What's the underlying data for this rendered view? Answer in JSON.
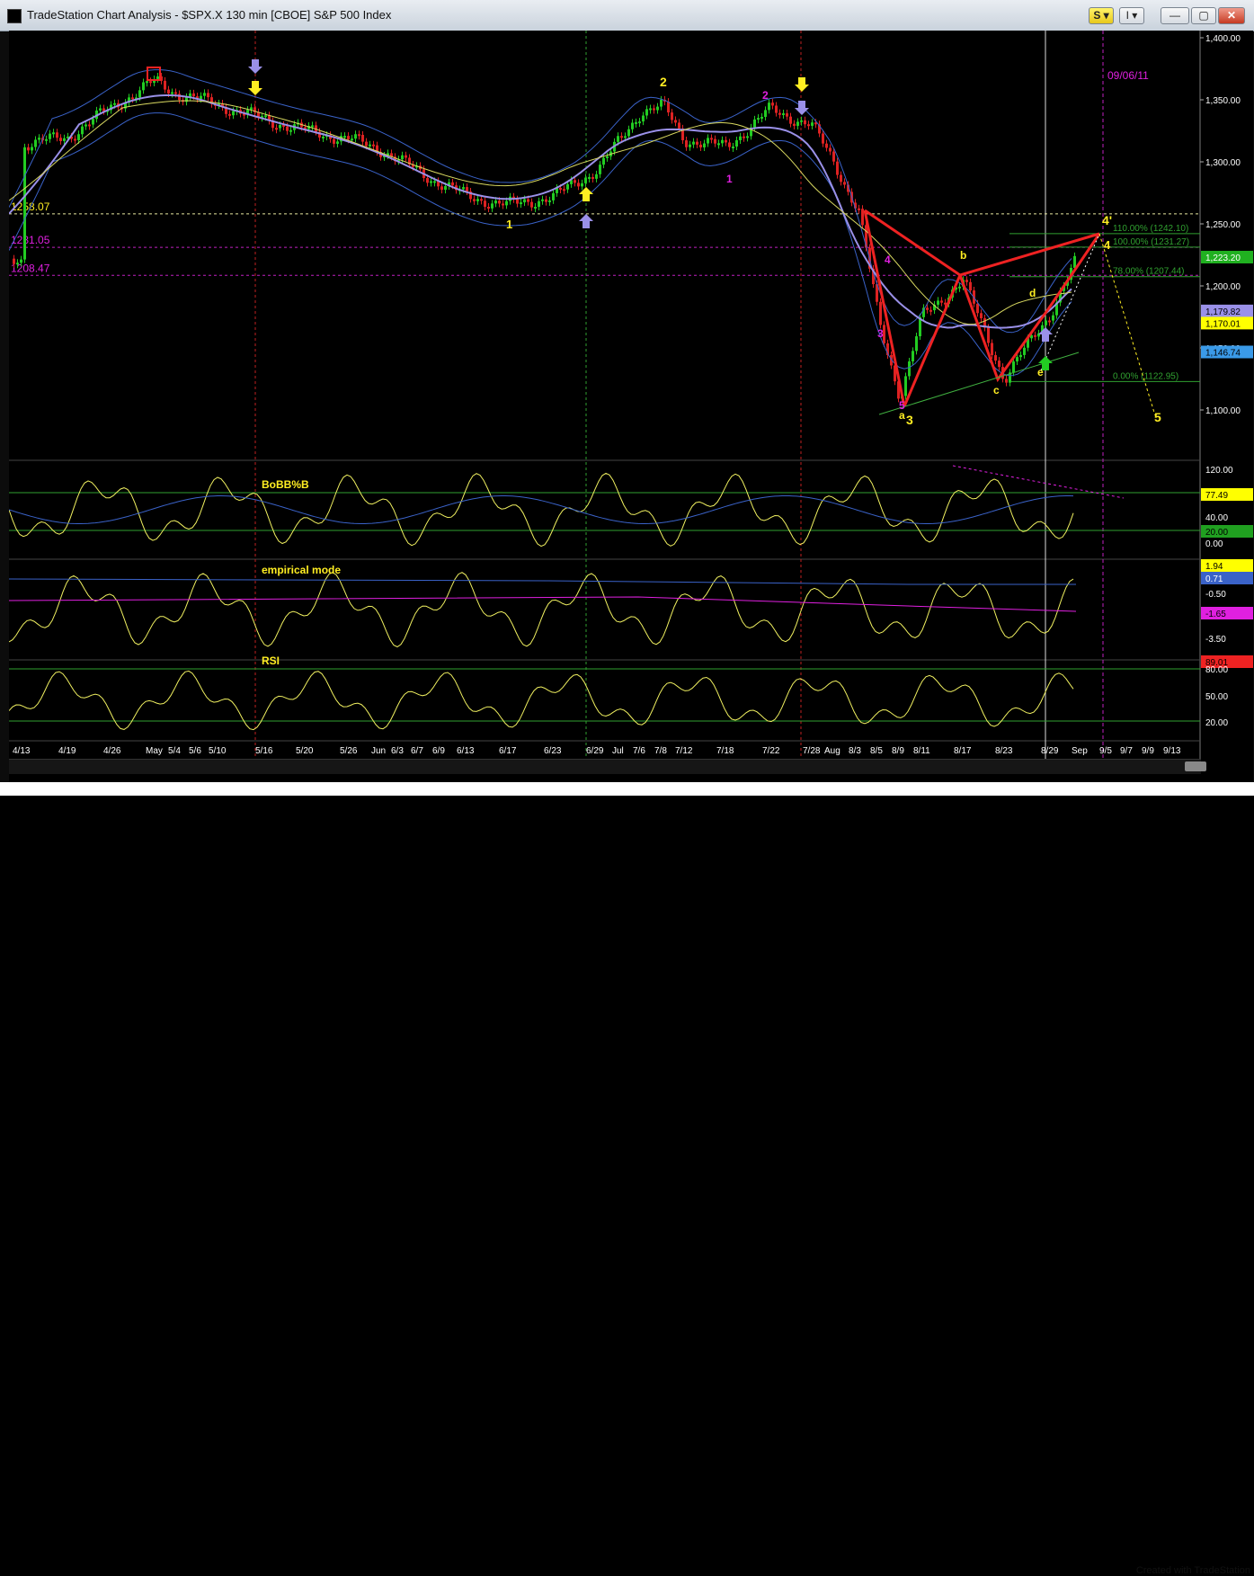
{
  "window": {
    "title": "TradeStation Chart Analysis - $SPX.X 130 min [CBOE] S&P 500 Index",
    "buttons": {
      "s": "S ▾",
      "indicator": "I ▾",
      "minimize": "—",
      "maximize": "▢",
      "close": "✕"
    },
    "credit": "Created with TradeStation"
  },
  "colors": {
    "background": "#000000",
    "price_bar": "#22cc22",
    "price_bar_down": "#dd2222",
    "bollinger": "#3a62c8",
    "ma_purple": "#9a90e8",
    "ma_yellow": "#d8d860",
    "wave_label": "#ffee22",
    "wave_label_magenta": "#e020e0",
    "pattern_red": "#ee2222",
    "hline_magenta": "#c020c0",
    "hline_yellow": "#e8e8a0",
    "fib_green": "#30a030",
    "indicator_line": "#f0f060",
    "axis_text": "#ffffff"
  },
  "price_axis": {
    "ticks": [
      "1,400.00",
      "1,350.00",
      "1,300.00",
      "1,250.00",
      "1,200.00",
      "1,150.00",
      "1,100.00"
    ],
    "badges": [
      {
        "value": 1223.2,
        "label": "1,223.20",
        "bg": "#20b020",
        "fg": "#ffffff"
      },
      {
        "value": 1179.82,
        "label": "1,179.82",
        "bg": "#9a90e8",
        "fg": "#000000"
      },
      {
        "value": 1170.01,
        "label": "1,170.01",
        "bg": "#ffff00",
        "fg": "#000000"
      },
      {
        "value": 1146.74,
        "label": "1,146.74",
        "bg": "#3a9ae8",
        "fg": "#000000"
      }
    ]
  },
  "horizontal_levels": [
    {
      "value": 1258.07,
      "label": "1258.07",
      "color": "#e8e8a0",
      "label_color": "#ffee22"
    },
    {
      "value": 1231.05,
      "label": "1231.05",
      "color": "#c020c0",
      "label_color": "#e020e0"
    },
    {
      "value": 1208.47,
      "label": "1208.47",
      "color": "#c020c0",
      "label_color": "#e020e0"
    }
  ],
  "fib_labels": [
    {
      "value": 1242.1,
      "label": "110.00% (1242.10)"
    },
    {
      "value": 1231.27,
      "label": "100.00% (1231.27)"
    },
    {
      "value": 1207.44,
      "label": "78.00% (1207.44)"
    },
    {
      "value": 1122.95,
      "label": "0.00% (1122.95)"
    }
  ],
  "date_marker": "09/06/11",
  "x_axis_labels": [
    "4/13",
    "4/19",
    "4/26",
    "May",
    "5/4",
    "5/6",
    "5/10",
    "5/16",
    "5/20",
    "5/26",
    "Jun",
    "6/3",
    "6/7",
    "6/9",
    "6/13",
    "6/17",
    "6/23",
    "6/29",
    "Jul",
    "7/6",
    "7/8",
    "7/12",
    "7/18",
    "7/22",
    "7/28",
    "Aug",
    "8/3",
    "8/5",
    "8/9",
    "8/11",
    "8/17",
    "8/23",
    "8/29",
    "Sep",
    "9/5",
    "9/7",
    "9/9",
    "9/13"
  ],
  "wave_labels": [
    {
      "text": "1",
      "color": "#ffee22"
    },
    {
      "text": "2",
      "color": "#ffee22"
    },
    {
      "text": "2",
      "color": "#e020e0"
    },
    {
      "text": "1",
      "color": "#e020e0"
    },
    {
      "text": "3",
      "color": "#e020e0"
    },
    {
      "text": "4",
      "color": "#e020e0"
    },
    {
      "text": "5",
      "color": "#e020e0"
    },
    {
      "text": "a",
      "color": "#ffee22"
    },
    {
      "text": "3",
      "color": "#ffee22"
    },
    {
      "text": "b",
      "color": "#ffee22"
    },
    {
      "text": "c",
      "color": "#ffee22"
    },
    {
      "text": "d",
      "color": "#ffee22"
    },
    {
      "text": "e",
      "color": "#ffee22"
    },
    {
      "text": "4'",
      "color": "#ffee22"
    },
    {
      "text": "4",
      "color": "#ffee22"
    },
    {
      "text": "5",
      "color": "#ffee22"
    }
  ],
  "indicators": [
    {
      "name": "BoBB%B",
      "ticks": [
        "120.00",
        "40.00",
        "0.00"
      ],
      "badges": [
        {
          "label": "77.49",
          "bg": "#ffff00",
          "fg": "#000000"
        },
        {
          "label": "20.00",
          "bg": "#20a020",
          "fg": "#000000"
        }
      ]
    },
    {
      "name": "empirical mode",
      "ticks": [
        "-0.50",
        "-3.50"
      ],
      "badges": [
        {
          "label": "1.94",
          "bg": "#ffff00",
          "fg": "#000000"
        },
        {
          "label": "0.71",
          "bg": "#3a62c8",
          "fg": "#ffffff"
        },
        {
          "label": "-1.65",
          "bg": "#e020e0",
          "fg": "#000000"
        }
      ]
    },
    {
      "name": "RSI",
      "ticks": [
        "80.00",
        "50.00",
        "20.00"
      ],
      "badges": [
        {
          "label": "89.01",
          "bg": "#ee2222",
          "fg": "#000000"
        }
      ]
    }
  ],
  "chart_data": {
    "type": "line",
    "title": "$SPX.X 130 min [CBOE] S&P 500 Index",
    "xlabel": "",
    "ylabel": "",
    "ylim": [
      1070,
      1410
    ],
    "series": [
      {
        "x": [
          "4/13",
          "4/19",
          "4/26",
          "May",
          "5/4",
          "5/10",
          "5/16",
          "5/20",
          "5/26",
          "Jun",
          "6/7",
          "6/13",
          "6/17",
          "6/23",
          "6/29",
          "Jul",
          "7/6",
          "7/8",
          "7/12",
          "7/18",
          "7/22",
          "7/28",
          "Aug",
          "8/3",
          "8/5",
          "8/9",
          "8/11",
          "8/17",
          "8/23",
          "8/29",
          "Sep"
        ],
        "values": [
          1314,
          1320,
          1345,
          1365,
          1355,
          1346,
          1334,
          1325,
          1318,
          1310,
          1290,
          1272,
          1265,
          1272,
          1295,
          1315,
          1341,
          1345,
          1318,
          1312,
          1342,
          1330,
          1300,
          1260,
          1170,
          1110,
          1175,
          1205,
          1125,
          1178,
          1222
        ]
      }
    ]
  }
}
